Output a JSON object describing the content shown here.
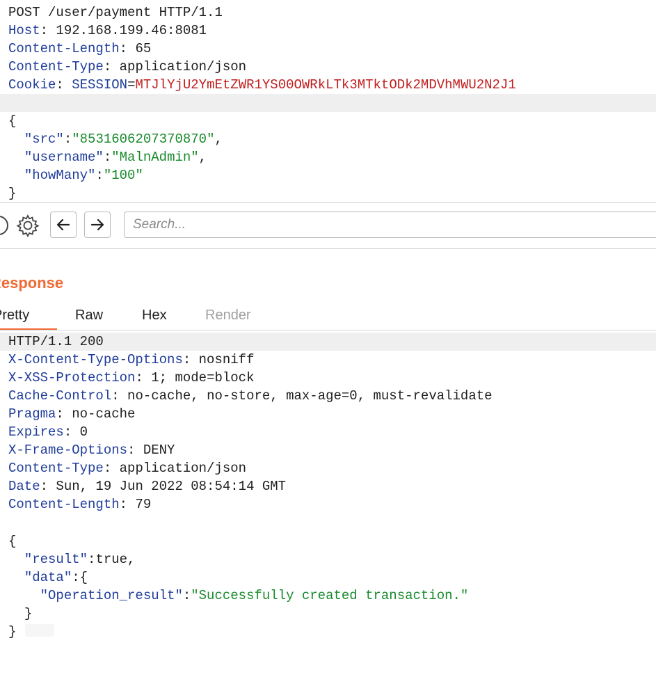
{
  "request": {
    "start_line": "POST /user/payment HTTP/1.1",
    "headers": [
      {
        "name": "Host",
        "value": "192.168.199.46:8081"
      },
      {
        "name": "Content-Length",
        "value": "65"
      },
      {
        "name": "Content-Type",
        "value": "application/json"
      },
      {
        "name": "Cookie",
        "cookie_name": "SESSION",
        "cookie_value": "MTJlYjU2YmEtZWR1YS00OWRkLTk3MTktODk2MDVhMWU2N2J1"
      }
    ],
    "body": {
      "open": "{",
      "src_key": "\"src\"",
      "src_value": "\"8531606207370870\"",
      "username_key": "\"username\"",
      "username_value": "\"MalnAdmin\"",
      "howmany_key": "\"howMany\"",
      "howmany_value": "\"100\"",
      "close": "}"
    }
  },
  "toolbar": {
    "search_placeholder": "Search..."
  },
  "response": {
    "title": "Response",
    "tabs": [
      {
        "label": "Pretty",
        "active": true
      },
      {
        "label": "Raw"
      },
      {
        "label": "Hex"
      },
      {
        "label": "Render",
        "disabled": true
      }
    ],
    "status_line": "HTTP/1.1 200",
    "headers": [
      {
        "name": "X-Content-Type-Options",
        "value": "nosniff"
      },
      {
        "name": "X-XSS-Protection",
        "value": "1; mode=block"
      },
      {
        "name": "Cache-Control",
        "value": "no-cache, no-store, max-age=0, must-revalidate"
      },
      {
        "name": "Pragma",
        "value": "no-cache"
      },
      {
        "name": "Expires",
        "value": "0"
      },
      {
        "name": "X-Frame-Options",
        "value": "DENY"
      },
      {
        "name": "Content-Type",
        "value": "application/json"
      },
      {
        "name": "Date",
        "value": "Sun, 19 Jun 2022 08:54:14 GMT"
      },
      {
        "name": "Content-Length",
        "value": "79"
      }
    ],
    "body": {
      "open": "{",
      "result_key": "\"result\"",
      "result_value": "true",
      "data_key": "\"data\"",
      "inner_open": "{",
      "op_key": "\"Operation_result\"",
      "op_value": "\"Successfully created transaction.\"",
      "inner_close": "}",
      "close": "}"
    }
  },
  "colors": {
    "accent": "#ef6a36",
    "header_key": "#1f3c9a",
    "string_value": "#178a2b",
    "cookie_value": "#c21d1d"
  }
}
